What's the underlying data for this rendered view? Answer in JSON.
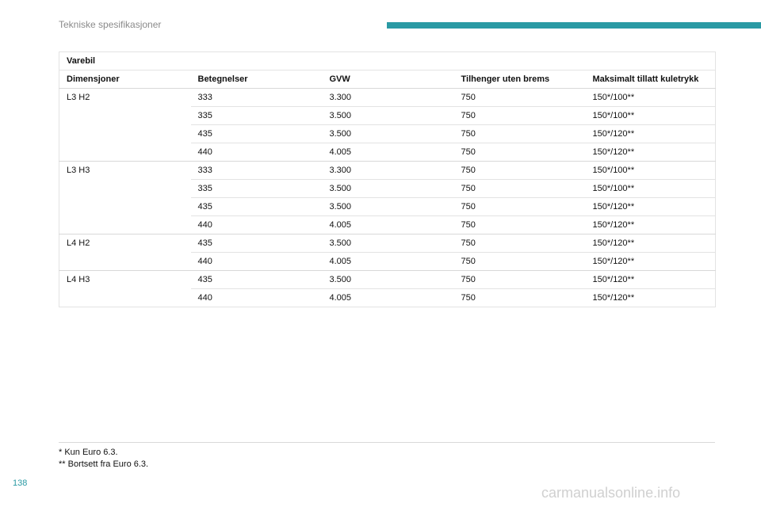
{
  "header": {
    "section_title": "Tekniske spesifikasjoner",
    "accent_color": "#2a9aa4"
  },
  "table": {
    "title": "Varebil",
    "columns": [
      "Dimensjoner",
      "Betegnelser",
      "GVW",
      "Tilhenger uten brems",
      "Maksimalt tillatt kuletrykk"
    ],
    "groups": [
      {
        "dimension": "L3 H2",
        "rows": [
          [
            "333",
            "3.300",
            "750",
            "150*/100**"
          ],
          [
            "335",
            "3.500",
            "750",
            "150*/100**"
          ],
          [
            "435",
            "3.500",
            "750",
            "150*/120**"
          ],
          [
            "440",
            "4.005",
            "750",
            "150*/120**"
          ]
        ]
      },
      {
        "dimension": "L3 H3",
        "rows": [
          [
            "333",
            "3.300",
            "750",
            "150*/100**"
          ],
          [
            "335",
            "3.500",
            "750",
            "150*/100**"
          ],
          [
            "435",
            "3.500",
            "750",
            "150*/120**"
          ],
          [
            "440",
            "4.005",
            "750",
            "150*/120**"
          ]
        ]
      },
      {
        "dimension": "L4 H2",
        "rows": [
          [
            "435",
            "3.500",
            "750",
            "150*/120**"
          ],
          [
            "440",
            "4.005",
            "750",
            "150*/120**"
          ]
        ]
      },
      {
        "dimension": "L4 H3",
        "rows": [
          [
            "435",
            "3.500",
            "750",
            "150*/120**"
          ],
          [
            "440",
            "4.005",
            "750",
            "150*/120**"
          ]
        ]
      }
    ]
  },
  "footnotes": [
    "* Kun Euro 6.3.",
    "** Bortsett fra Euro 6.3."
  ],
  "page_number": "138",
  "watermark": "carmanualsonline.info"
}
